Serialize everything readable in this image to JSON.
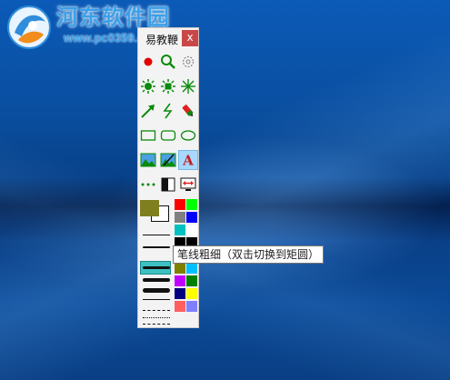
{
  "watermark": {
    "title": "河东软件园",
    "url": "www.pc0359.cn"
  },
  "toolbox": {
    "title": "易教鞭",
    "close_label": "x",
    "tools": {
      "row1": [
        "red-dot-icon",
        "magnifier-icon",
        "settings-icon"
      ],
      "row2": [
        "spotlight-circle-icon",
        "spotlight-square-icon",
        "sparkle-icon"
      ],
      "row3": [
        "arrow-icon",
        "lightning-icon",
        "marker-icon"
      ],
      "row4": [
        "rectangle-icon",
        "rounded-rectangle-icon",
        "ellipse-icon"
      ],
      "row5": [
        "picture-icon",
        "image-edit-icon",
        "text-icon"
      ],
      "row6": [
        "dotted-line-icon",
        "contrast-toggle-icon",
        "swap-screen-icon"
      ]
    },
    "foreground_color": "#7f7f1f",
    "background_color": "#ffffff",
    "palette": [
      "#ff0000",
      "#00ff00",
      "#808080",
      "#0000ff",
      "#00c0c0",
      "#ffffff",
      "#000000",
      "#000000",
      "#c0ff00",
      "#000000",
      "#808000",
      "#00c0ff",
      "#c000ff",
      "#008000",
      "#000080",
      "#ffff00",
      "#ff6060",
      "#8080ff"
    ]
  },
  "tooltip": {
    "text": "笔线粗细（双击切换到矩圆）"
  },
  "colors": {
    "panel_bg": "#f3f3f3",
    "close_bg": "#c94747",
    "tool_green": "#0a8a0a",
    "selection_cyan": "#3cc0c0"
  }
}
